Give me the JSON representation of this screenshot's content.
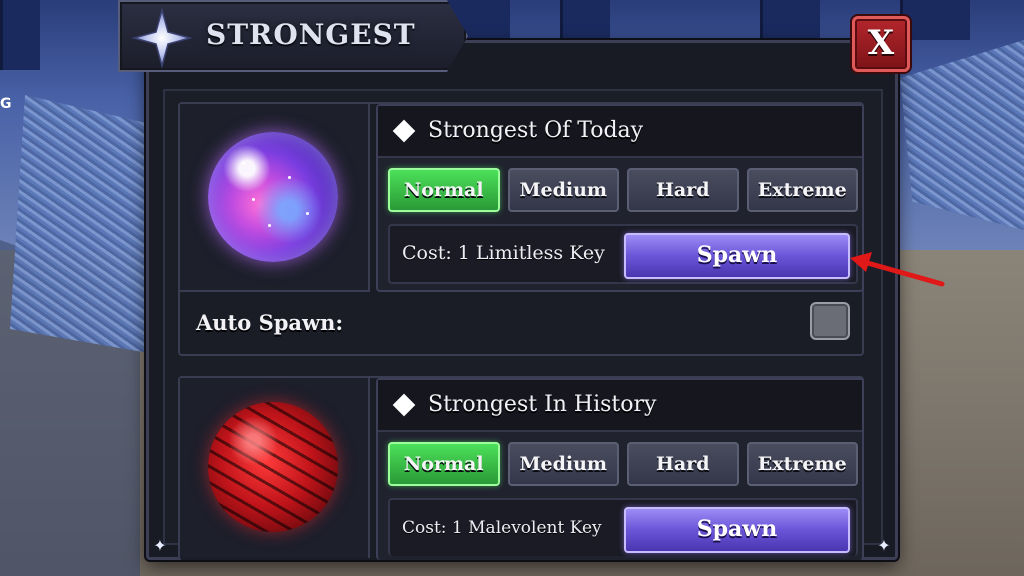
{
  "window": {
    "title": "STRONGEST",
    "close_label": "X"
  },
  "bosses": [
    {
      "title": "Strongest Of Today",
      "difficulties": [
        "Normal",
        "Medium",
        "Hard",
        "Extreme"
      ],
      "selected_difficulty": "Normal",
      "cost": "Cost: 1 Limitless Key",
      "spawn_label": "Spawn",
      "orb_color": "#b04ae0",
      "auto_spawn_label": "Auto Spawn:",
      "auto_spawn_enabled": false
    },
    {
      "title": "Strongest In History",
      "difficulties": [
        "Normal",
        "Medium",
        "Hard",
        "Extreme"
      ],
      "selected_difficulty": "Normal",
      "cost": "Cost: 1 Malevolent Key",
      "spawn_label": "Spawn",
      "orb_color": "#c0141a"
    }
  ],
  "colors": {
    "selected_difficulty": "#2a9a36",
    "spawn_button": "#6a55d8",
    "close_button": "#b3262c",
    "annotation_arrow": "#e01818"
  },
  "icons": {
    "title": "four-point-star-icon",
    "close": "close-icon",
    "boss_marker": "diamond-icon",
    "annotation": "red-arrow-icon"
  }
}
